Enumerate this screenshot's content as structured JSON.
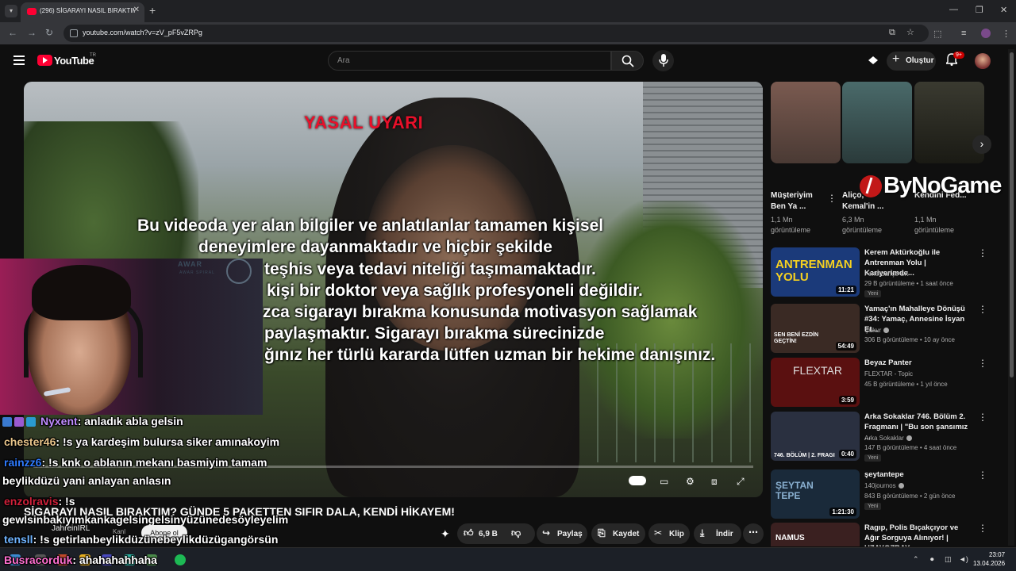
{
  "browser": {
    "tab_title": "(296) SİGARAYI NASIL BIRAKTIM",
    "tab_close": "✕",
    "new_tab": "+",
    "url": "youtube.com/watch?v=zV_pF5vZRPg"
  },
  "youtube": {
    "logo_text": "YouTube",
    "region": "TR",
    "search_placeholder": "Ara",
    "create_label": "Oluştur",
    "notifications": "9+"
  },
  "video": {
    "warning_title": "YASAL UYARI",
    "warning_lines": [
      "Bu videoda yer alan bilgiler ve anlatılanlar tamamen kişisel",
      "deneyimlere dayanmaktadır ve hiçbir şekilde",
      "teşhis veya tedavi niteliği taşımamaktadır.",
      "kişi bir doktor veya sağlık profesyoneli değildir.",
      "zca sigarayı bırakma konusunda motivasyon sağlamak",
      "paylaşmaktır. Sigarayı bırakma sürecinizde",
      "ğınız her türlü kararda lütfen uzman bir hekime danışınız."
    ],
    "cam_sign": "AWAR",
    "cam_sign_sub": "AWAR SPIRAL",
    "title": "SİGARAYI NASIL BIRAKTIM? GÜNDE 5 PAKETTEN SIFIR DALA, KENDİ HİKAYEM!",
    "channel": "JahreinIRL",
    "subs": "Kanl",
    "subscribe": "Abone ol",
    "likes": "6,9 B",
    "share": "Paylaş",
    "save": "Kaydet",
    "clip": "Klip",
    "download": "İndir"
  },
  "chat": [
    {
      "user": "Nyxent",
      "color": "#c08cff",
      "msg": ": anladık abla gelsin"
    },
    {
      "user": "chester46",
      "color": "#e8c48a",
      "msg": ": !s ya kardeşim bulursa siker amınakoyim"
    },
    {
      "user": "rainzz6",
      "color": "#2f7bff",
      "msg": ": !s knk o ablanın mekanı basmiyim tamam"
    },
    {
      "user": "",
      "color": "#ffffff",
      "msg": "beylikdüzü yani anlayan anlasın"
    },
    {
      "user": "enzolravis",
      "color": "#d0203a",
      "msg": ": !s"
    },
    {
      "user": "",
      "color": "#ffffff",
      "msg": "gewlsinbakıyımkankagelsingelsinyüzünedesöyleyelim"
    },
    {
      "user": "tensll",
      "color": "#6fb4ff",
      "msg": ": !s getirlanbeylikdüzünebeylikdüzügangörsün"
    },
    {
      "user": "Busracorduk",
      "color": "#ff6fd0",
      "msg": ": ahahahahhaha"
    }
  ],
  "shorts": [
    {
      "title": "Müşteriyim Ben Ya ...",
      "views": "1,1 Mn görüntüleme"
    },
    {
      "title": "Aliço, Kemal'in ...",
      "views": "6,3 Mn görüntüleme"
    },
    {
      "title": "Kendini Fed...",
      "views": "1,1 Mn görüntüleme"
    }
  ],
  "watermark": "ByNoGame",
  "recommendations": [
    {
      "title": "Kerem Aktürkoğlu ile Antrenman Yolu | Kariyerimde...",
      "channel": "Fenerbahçe SK",
      "meta": "29 B görüntüleme • 1 saat önce",
      "duration": "11:21",
      "new": "Yeni",
      "thumb_text": "ANTRENMAN YOLU",
      "color": "#1b3a7a"
    },
    {
      "title": "Yamaç'ın Mahalleye Dönüşü #34: Yamaç, Annesine İsyan Et...",
      "channel": "Çukur",
      "meta": "306 B görüntüleme • 10 ay önce",
      "duration": "54:49",
      "new": "",
      "thumb_text": "SEN BENİ EZDİN GEÇTİN!",
      "color": "#3a2a24"
    },
    {
      "title": "Beyaz Panter",
      "channel": "FLEXTAR - Topic",
      "meta": "45 B görüntüleme • 1 yıl önce",
      "duration": "3:59",
      "new": "",
      "thumb_text": "FLEXTAR",
      "color": "#5a1010"
    },
    {
      "title": "Arka Sokaklar 746. Bölüm 2. Fragmanı | \"Bu son şansımız ...",
      "channel": "Arka Sokaklar",
      "meta": "147 B görüntüleme • 4 saat önce",
      "duration": "0:40",
      "new": "Yeni",
      "thumb_text": "746. BÖLÜM | 2. FRAGI",
      "color": "#2a3040"
    },
    {
      "title": "şeytantepe",
      "channel": "140journos",
      "meta": "843 B görüntüleme • 2 gün önce",
      "duration": "1:21:30",
      "new": "Yeni",
      "thumb_text": "ŞEYTAN TEPE",
      "color": "#1a2a3a"
    },
    {
      "title": "Ragıp, Polis Bıçakçıyor ve Ağır Sorguya Alınıyor! | UZAYOZBAY",
      "channel": "",
      "meta": "",
      "duration": "",
      "new": "",
      "thumb_text": "NAMUS",
      "color": "#3a2020"
    }
  ],
  "taskbar": {
    "time": "23:07",
    "date": "13.04.2026"
  }
}
